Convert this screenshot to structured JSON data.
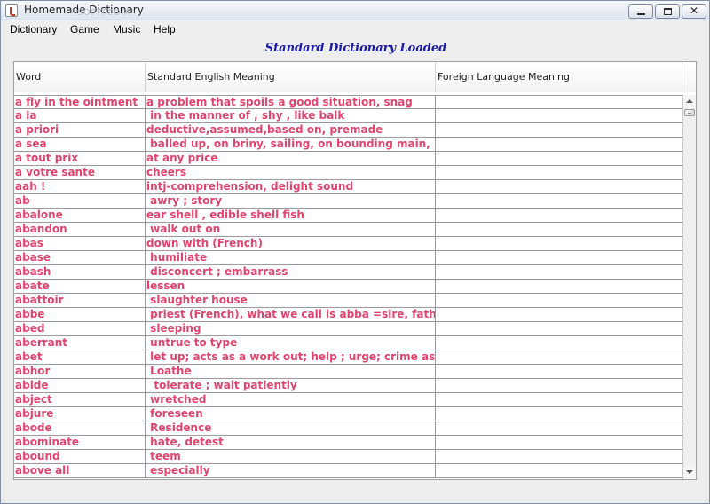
{
  "window": {
    "title": "Homemade Dictionary",
    "watermark": "SOFTPEDIA",
    "minimize_label": "",
    "maximize_label": "",
    "close_glyph": "✕"
  },
  "menu": [
    "Dictionary",
    "Game",
    "Music",
    "Help"
  ],
  "status": "Standard Dictionary Loaded",
  "table": {
    "columns": [
      "Word",
      "Standard English Meaning",
      "Foreign Language Meaning"
    ],
    "rows": [
      [
        "a fly in the ointment",
        "a problem that spoils a good situation, snag",
        ""
      ],
      [
        "a la",
        " in the manner of , shy , like balk",
        ""
      ],
      [
        "a priori",
        "deductive,assumed,based on, premade",
        ""
      ],
      [
        "a sea",
        " balled up, on briny, sailing, on bounding main, ...",
        ""
      ],
      [
        "a tout prix",
        "at any price",
        ""
      ],
      [
        "a votre sante",
        "cheers",
        ""
      ],
      [
        "aah !",
        "intj-comprehension, delight sound",
        ""
      ],
      [
        "ab",
        " awry ; story",
        ""
      ],
      [
        "abalone",
        "ear shell , edible shell fish",
        ""
      ],
      [
        "abandon",
        " walk out on",
        ""
      ],
      [
        "abas",
        "down with (French)",
        ""
      ],
      [
        "abase",
        " humiliate",
        ""
      ],
      [
        "abash",
        " disconcert ; embarrass",
        ""
      ],
      [
        "abate",
        "lessen",
        ""
      ],
      [
        "abattoir",
        " slaughter house",
        ""
      ],
      [
        "abbe",
        " priest (French), what we call is abba =sire, father",
        ""
      ],
      [
        "abed",
        " sleeping",
        ""
      ],
      [
        "aberrant",
        " untrue to type",
        ""
      ],
      [
        "abet",
        " let up; acts as a work out; help ; urge; crime assi...",
        ""
      ],
      [
        "abhor",
        " Loathe",
        ""
      ],
      [
        "abide",
        "  tolerate ; wait patiently",
        ""
      ],
      [
        "abject",
        " wretched",
        ""
      ],
      [
        "abjure",
        " foreseen",
        ""
      ],
      [
        "abode",
        " Residence",
        ""
      ],
      [
        "abominate",
        " hate, detest",
        ""
      ],
      [
        "abound",
        " teem",
        ""
      ],
      [
        "above all",
        " especially",
        ""
      ]
    ]
  },
  "colors": {
    "entry_text": "#e0456e",
    "status_text": "#1a1aa8",
    "grid_line": "#9a9a9a"
  }
}
